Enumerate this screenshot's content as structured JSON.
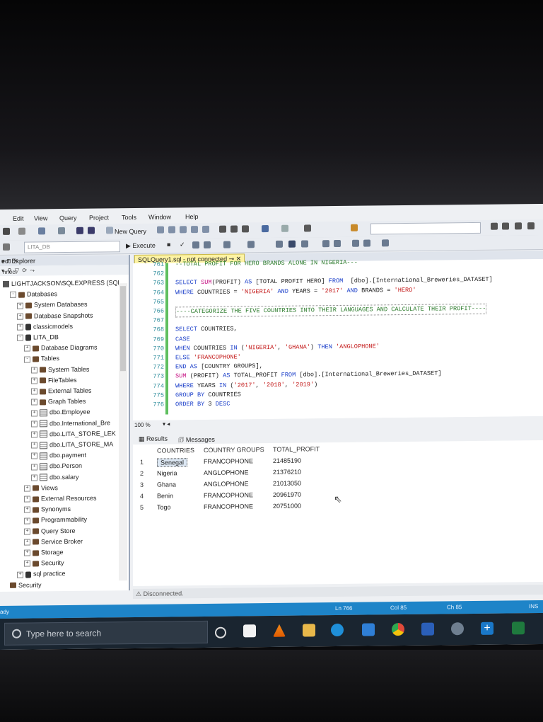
{
  "menu": [
    "Edit",
    "View",
    "Query",
    "Project",
    "Tools",
    "Window",
    "Help"
  ],
  "toolbar": {
    "new_query": "New Query",
    "execute": "Execute",
    "database": "LITA_DB"
  },
  "object_explorer": {
    "title": "ect Explorer",
    "connect": "nnect",
    "tree": [
      {
        "label": "LIGHTJACKSON\\SQLEXPRESS (SQL",
        "indent": 0,
        "icon": "server-icon",
        "exp": ""
      },
      {
        "label": "Databases",
        "indent": 1,
        "icon": "folder-icon",
        "exp": "-"
      },
      {
        "label": "System Databases",
        "indent": 2,
        "icon": "folder-icon",
        "exp": "+"
      },
      {
        "label": "Database Snapshots",
        "indent": 2,
        "icon": "folder-icon",
        "exp": "+"
      },
      {
        "label": "classicmodels",
        "indent": 2,
        "icon": "database-icon",
        "exp": "+"
      },
      {
        "label": "LITA_DB",
        "indent": 2,
        "icon": "database-icon",
        "exp": "-"
      },
      {
        "label": "Database Diagrams",
        "indent": 3,
        "icon": "folder-icon",
        "exp": "+"
      },
      {
        "label": "Tables",
        "indent": 3,
        "icon": "folder-icon",
        "exp": "-"
      },
      {
        "label": "System Tables",
        "indent": 4,
        "icon": "folder-icon",
        "exp": "+"
      },
      {
        "label": "FileTables",
        "indent": 4,
        "icon": "folder-icon",
        "exp": "+"
      },
      {
        "label": "External Tables",
        "indent": 4,
        "icon": "folder-icon",
        "exp": "+"
      },
      {
        "label": "Graph Tables",
        "indent": 4,
        "icon": "folder-icon",
        "exp": "+"
      },
      {
        "label": "dbo.Employee",
        "indent": 4,
        "icon": "table-icon",
        "exp": "+"
      },
      {
        "label": "dbo.International_Bre",
        "indent": 4,
        "icon": "table-icon",
        "exp": "+"
      },
      {
        "label": "dbo.LITA_STORE_LEK",
        "indent": 4,
        "icon": "table-icon",
        "exp": "+"
      },
      {
        "label": "dbo.LITA_STORE_MA",
        "indent": 4,
        "icon": "table-icon",
        "exp": "+"
      },
      {
        "label": "dbo.payment",
        "indent": 4,
        "icon": "table-icon",
        "exp": "+"
      },
      {
        "label": "dbo.Person",
        "indent": 4,
        "icon": "table-icon",
        "exp": "+"
      },
      {
        "label": "dbo.salary",
        "indent": 4,
        "icon": "table-icon",
        "exp": "+"
      },
      {
        "label": "Views",
        "indent": 3,
        "icon": "folder-icon",
        "exp": "+"
      },
      {
        "label": "External Resources",
        "indent": 3,
        "icon": "folder-icon",
        "exp": "+"
      },
      {
        "label": "Synonyms",
        "indent": 3,
        "icon": "folder-icon",
        "exp": "+"
      },
      {
        "label": "Programmability",
        "indent": 3,
        "icon": "folder-icon",
        "exp": "+"
      },
      {
        "label": "Query Store",
        "indent": 3,
        "icon": "folder-icon",
        "exp": "+"
      },
      {
        "label": "Service Broker",
        "indent": 3,
        "icon": "folder-icon",
        "exp": "+"
      },
      {
        "label": "Storage",
        "indent": 3,
        "icon": "folder-icon",
        "exp": "+"
      },
      {
        "label": "Security",
        "indent": 3,
        "icon": "folder-icon",
        "exp": "+"
      },
      {
        "label": "sql practice",
        "indent": 2,
        "icon": "database-icon",
        "exp": "+"
      },
      {
        "label": "Security",
        "indent": 1,
        "icon": "folder-icon",
        "exp": ""
      }
    ]
  },
  "editor": {
    "tab_label": "SQLQuery1.sql - not connected",
    "lines": [
      {
        "n": "761",
        "parts": [
          [
            "cm",
            "--TOTAL PROFIT FOR HERO BRANDS ALONE IN NIGERIA---"
          ]
        ]
      },
      {
        "n": "762",
        "parts": []
      },
      {
        "n": "763",
        "parts": [
          [
            "kw",
            "SELECT "
          ],
          [
            "fn",
            "SUM"
          ],
          [
            "pl",
            "(PROFIT) "
          ],
          [
            "kw",
            "AS "
          ],
          [
            "pl",
            "[TOTAL PROFIT HERO] "
          ],
          [
            "kw",
            "FROM "
          ],
          [
            "pl",
            " [dbo].[International_Breweries_DATASET]"
          ]
        ]
      },
      {
        "n": "764",
        "parts": [
          [
            "kw",
            "WHERE "
          ],
          [
            "pl",
            "COUNTRIES = "
          ],
          [
            "str",
            "'NIGERIA'"
          ],
          [
            "pl",
            " "
          ],
          [
            "kw",
            "AND "
          ],
          [
            "pl",
            "YEARS = "
          ],
          [
            "str",
            "'2017'"
          ],
          [
            "pl",
            " "
          ],
          [
            "kw",
            "AND "
          ],
          [
            "pl",
            "BRANDS = "
          ],
          [
            "str",
            "'HERO'"
          ]
        ]
      },
      {
        "n": "765",
        "parts": []
      },
      {
        "n": "766",
        "parts": [
          [
            "cm",
            "----CATEGORIZE THE FIVE COUNTRIES INTO THEIR LANGUAGES AND CALCULATE THEIR PROFIT----"
          ]
        ]
      },
      {
        "n": "767",
        "parts": []
      },
      {
        "n": "768",
        "parts": [
          [
            "kw",
            "SELECT "
          ],
          [
            "pl",
            "COUNTRIES,"
          ]
        ]
      },
      {
        "n": "769",
        "parts": [
          [
            "kw",
            "CASE"
          ]
        ]
      },
      {
        "n": "770",
        "parts": [
          [
            "kw",
            "WHEN "
          ],
          [
            "pl",
            "COUNTRIES "
          ],
          [
            "kw",
            "IN "
          ],
          [
            "pl",
            "("
          ],
          [
            "str",
            "'NIGERIA'"
          ],
          [
            "pl",
            ", "
          ],
          [
            "str",
            "'GHANA'"
          ],
          [
            "pl",
            ") "
          ],
          [
            "kw",
            "THEN "
          ],
          [
            "str",
            "'ANGLOPHONE'"
          ]
        ]
      },
      {
        "n": "771",
        "parts": [
          [
            "kw",
            "ELSE "
          ],
          [
            "str",
            "'FRANCOPHONE'"
          ]
        ]
      },
      {
        "n": "772",
        "parts": [
          [
            "kw",
            "END AS "
          ],
          [
            "pl",
            "[COUNTRY GROUPS],"
          ]
        ]
      },
      {
        "n": "773",
        "parts": [
          [
            "fn",
            "SUM "
          ],
          [
            "pl",
            "(PROFIT) "
          ],
          [
            "kw",
            "AS "
          ],
          [
            "pl",
            "TOTAL_PROFIT "
          ],
          [
            "kw",
            "FROM "
          ],
          [
            "pl",
            "[dbo].[International_Breweries_DATASET]"
          ]
        ]
      },
      {
        "n": "774",
        "parts": [
          [
            "kw",
            "WHERE "
          ],
          [
            "pl",
            "YEARS "
          ],
          [
            "kw",
            "IN "
          ],
          [
            "pl",
            "("
          ],
          [
            "str",
            "'2017'"
          ],
          [
            "pl",
            ", "
          ],
          [
            "str",
            "'2018'"
          ],
          [
            "pl",
            ", "
          ],
          [
            "str",
            "'2019'"
          ],
          [
            "pl",
            ")"
          ]
        ]
      },
      {
        "n": "775",
        "parts": [
          [
            "kw",
            "GROUP BY "
          ],
          [
            "pl",
            "COUNTRIES"
          ]
        ]
      },
      {
        "n": "776",
        "parts": [
          [
            "kw",
            "ORDER BY "
          ],
          [
            "pl",
            "3 "
          ],
          [
            "kw",
            "DESC"
          ]
        ]
      }
    ],
    "zoom": "100 %"
  },
  "results": {
    "tab_results": "Results",
    "tab_messages": "Messages",
    "columns": [
      "COUNTRIES",
      "COUNTRY GROUPS",
      "TOTAL_PROFIT"
    ],
    "rows": [
      [
        "1",
        "Senegal",
        "FRANCOPHONE",
        "21485190"
      ],
      [
        "2",
        "Nigeria",
        "ANGLOPHONE",
        "21376210"
      ],
      [
        "3",
        "Ghana",
        "ANGLOPHONE",
        "21013050"
      ],
      [
        "4",
        "Benin",
        "FRANCOPHONE",
        "20961970"
      ],
      [
        "5",
        "Togo",
        "FRANCOPHONE",
        "20751000"
      ]
    ],
    "connection_status": "Disconnected."
  },
  "statusbar": {
    "ready": "ady",
    "ln": "Ln 766",
    "col": "Col 85",
    "ch": "Ch 85",
    "ins": "INS"
  },
  "taskbar": {
    "search_placeholder": "Type here to search"
  }
}
